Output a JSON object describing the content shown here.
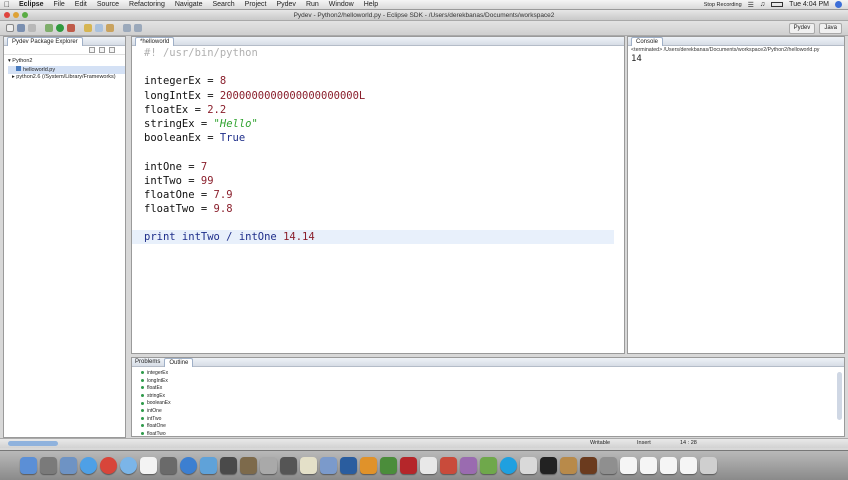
{
  "menubar": {
    "apple": "",
    "app": "Eclipse",
    "items": [
      "File",
      "Edit",
      "Source",
      "Refactoring",
      "Navigate",
      "Search",
      "Project",
      "Pydev",
      "Run",
      "Window",
      "Help"
    ],
    "recording": "Stop Recording",
    "clock": "Tue 4:04 PM"
  },
  "window": {
    "title": "Pydev - Python2/helloworld.py - Eclipse SDK - /Users/derekbanas/Documents/workspace2"
  },
  "perspectives": [
    "Pydev",
    "Java"
  ],
  "explorer": {
    "tab": "Pydev Package Explorer",
    "items": [
      "Python2",
      "helloworld.py",
      "python2.6  (/System/Library/Frameworks)"
    ]
  },
  "editor": {
    "tab": "*helloworld",
    "lines": {
      "l1": "#! /usr/bin/python",
      "l3a": "integerEx = ",
      "l3b": "8",
      "l4a": "longIntEx = ",
      "l4b": "2000000000000000000000L",
      "l5a": "floatEx = ",
      "l5b": "2.2",
      "l6a": "stringEx = ",
      "l6b": "\"Hello\"",
      "l7a": "booleanEx = ",
      "l7b": "True",
      "l9a": "intOne = ",
      "l9b": "7",
      "l10a": "intTwo = ",
      "l10b": "99",
      "l11a": "floatOne = ",
      "l11b": "7.9",
      "l12a": "floatTwo = ",
      "l12b": "9.8",
      "l14a": "print",
      "l14b": " intTwo / intOne ",
      "l14c": "14.14"
    }
  },
  "console": {
    "tab": "Console",
    "path": "<terminated> /Users/derekbanas/Documents/workspace2/Python2/helloworld.py",
    "output": "14"
  },
  "outline": {
    "tabs": [
      "Problems",
      "Outline"
    ],
    "items": [
      "integerEx",
      "longIntEx",
      "floatEx",
      "stringEx",
      "booleanEx",
      "intOne",
      "intTwo",
      "floatOne",
      "floatTwo"
    ]
  },
  "status": {
    "mode": "Writable",
    "insert": "Insert",
    "position": "14 : 28"
  },
  "colors": {
    "keyword": "#1e2e8a",
    "number": "#8a1f2c",
    "string": "#2fa32f",
    "comment": "#b0b0b0"
  }
}
